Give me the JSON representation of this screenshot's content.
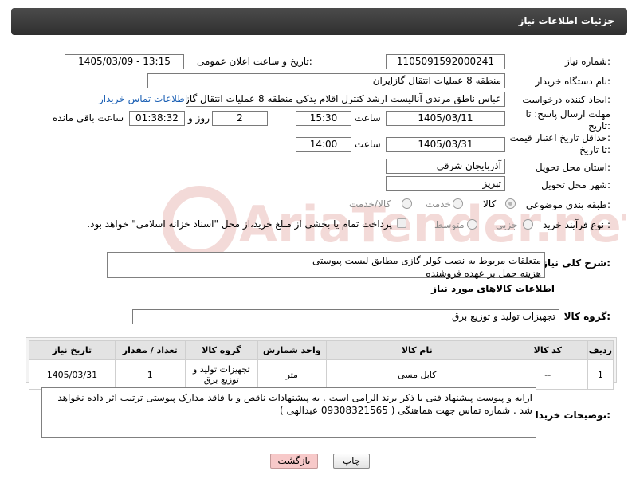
{
  "header": {
    "title": "جزئیات اطلاعات نیاز"
  },
  "fields": {
    "need_number_label": "شماره نیاز:",
    "need_number": "1105091592000241",
    "announce_label": "تاریخ و ساعت اعلان عمومی:",
    "announce_value": "1405/03/09 - 13:15",
    "buyer_org_label": "نام دستگاه خریدار:",
    "buyer_org": "منطقه 8 عملیات انتقال گازایران",
    "creator_label": "ایجاد کننده درخواست:",
    "creator": "عباس ناطق مرندی آنالیست ارشد کنترل اقلام یدکی منطقه 8 عملیات انتقال گاز ایران",
    "contact_link": "اطلاعات تماس خریدار",
    "deadline_label_1": "مهلت ارسال پاسخ: تا",
    "deadline_label_2": "تاریخ:",
    "deadline_date": "1405/03/11",
    "time_label": "ساعت",
    "deadline_time": "15:30",
    "days_value": "2",
    "days_label": "روز و",
    "remaining_time": "01:38:32",
    "remaining_label": "ساعت باقی مانده",
    "price_label_1": "حداقل تاریخ اعتبار قیمت:",
    "price_label_2": "تا تاریخ:",
    "price_date": "1405/03/31",
    "price_time": "14:00",
    "province_label": "استان محل تحویل:",
    "province": "آذربایجان شرقی",
    "city_label": "شهر محل تحویل:",
    "city": "تبریز",
    "category_label": "طبقه بندی موضوعی:",
    "category_options": [
      "کالا",
      "خدمت",
      "کالا/خدمت"
    ],
    "process_label": "نوع فرآیند خرید :",
    "process_options": [
      "جزیی",
      "متوسط"
    ],
    "payment_note": "پرداخت تمام یا بخشی از مبلغ خرید،از محل \"اسناد خزانه اسلامی\" خواهد بود."
  },
  "description": {
    "label": "شرح کلی نیاز:",
    "line1": "متعلقات مربوط به نصب کولر گازی مطابق لیست پیوستی",
    "line2": "هزینه حمل بر عهده فروشنده"
  },
  "goods": {
    "section_title": "اطلاعات کالاهای مورد نیاز",
    "group_label": "گروه کالا:",
    "group_value": "تجهیزات تولید و توزیع برق",
    "columns": [
      "ردیف",
      "کد کالا",
      "نام کالا",
      "واحد شمارش",
      "گروه کالا",
      "تعداد / مقدار",
      "تاریخ نیاز"
    ],
    "rows": [
      {
        "row": "1",
        "code": "--",
        "name": "کابل مسی",
        "unit": "متر",
        "group_line1": "تجهیزات تولید و",
        "group_line2": "توزیع برق",
        "qty": "1",
        "date": "1405/03/31"
      }
    ]
  },
  "buyer_notes": {
    "label": "توضیحات خریدار:",
    "line1": "ارایه و پیوست پیشنهاد فنی با ذکر برند الزامی است . به پیشنهادات ناقص و یا فاقد مدارک پیوستی ترتیب اثر داده نخواهد",
    "line2": "شد . شماره تماس جهت هماهنگی ( 09308321565 عبدالهی )"
  },
  "buttons": {
    "print": "چاپ",
    "back": "بازگشت"
  },
  "watermark": {
    "text": "AriaTender.net"
  }
}
